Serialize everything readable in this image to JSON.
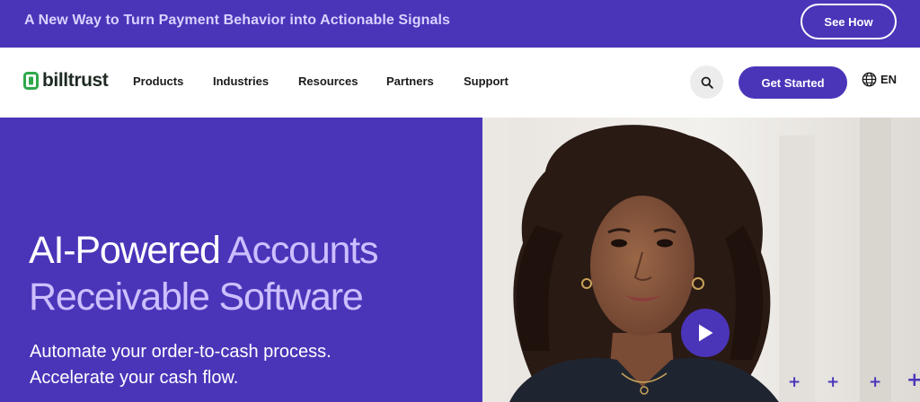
{
  "announcement": {
    "text": "A New Way to Turn Payment Behavior into Actionable Signals",
    "cta_label": "See How"
  },
  "nav": {
    "logo_text": "billtrust",
    "items": [
      {
        "label": "Products"
      },
      {
        "label": "Industries"
      },
      {
        "label": "Resources"
      },
      {
        "label": "Partners"
      },
      {
        "label": "Support"
      }
    ],
    "search_icon": "search-icon",
    "get_started_label": "Get Started",
    "language_label": "EN",
    "language_icon": "globe-icon"
  },
  "hero": {
    "title_plain": "AI-Powered",
    "title_accent": "Accounts Receivable Software",
    "subtitle_line1": "Automate your order-to-cash process.",
    "subtitle_line2": "Accelerate your cash flow.",
    "play_icon": "play-icon"
  },
  "colors": {
    "brand_purple": "#4a35b9",
    "accent_lavender": "#cdbfff",
    "logo_green": "#2ea84a"
  }
}
